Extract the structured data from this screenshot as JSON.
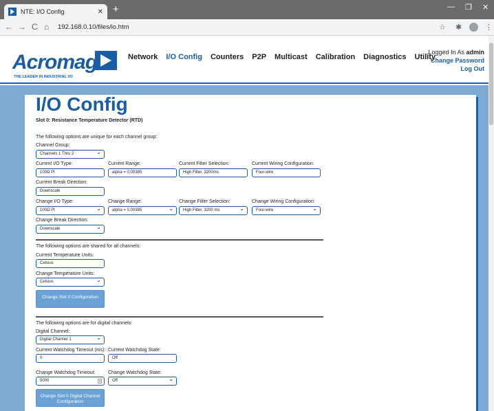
{
  "browser": {
    "tab_title": "NTE: I/O Config",
    "url": "192.168.0.10/files/io.htm"
  },
  "header": {
    "brand": "Acromag",
    "tagline": "THE LEADER IN INDUSTRIAL I/O",
    "nav": [
      "Network",
      "I/O Config",
      "Counters",
      "P2P",
      "Multicast",
      "Calibration",
      "Diagnostics",
      "Utility"
    ],
    "logged_in_prefix": "Logged In As ",
    "user": "admin",
    "change_password": "Change Password",
    "logout": "Log Out"
  },
  "main": {
    "title": "I/O Config",
    "slot_title": "Slot 0: Resistance Temperature Detector (RTD)",
    "unique_note": "The following options are unique for each channel group:",
    "channel_group_label": "Channel Group:",
    "channel_group_value": "Channels 1 Thru 2",
    "current_io_type_label": "Current I/O Type:",
    "current_io_type": "100Ω Pt",
    "current_range_label": "Current Range:",
    "current_range": "alpha = 0.00385",
    "current_filter_label": "Current Filter Selection:",
    "current_filter": "High Filter, 3200ms",
    "current_wiring_label": "Current Wiring Configuration:",
    "current_wiring": "Four-wire",
    "current_break_label": "Current Break Direction:",
    "current_break": "Downscale",
    "change_io_type_label": "Change I/O Type:",
    "change_io_type": "100Ω Pt",
    "change_range_label": "Change Range:",
    "change_range": "alpha = 0.00385",
    "change_filter_label": "Change Filter Selection:",
    "change_filter": "High Filter, 3200 ms",
    "change_wiring_label": "Change Wiring Configuration:",
    "change_wiring": "Four-wire",
    "change_break_label": "Change Break Direction:",
    "change_break": "Downscale",
    "shared_note": "The following options are shared for all channels:",
    "current_temp_units_label": "Current Temperature Units:",
    "current_temp_units": "Celsius",
    "change_temp_units_label": "Change Temperature Units:",
    "change_temp_units": "Celsius",
    "change_config_button": "Change Slot 0 Configuration",
    "digital_note": "The following options are for digital channels:",
    "digital_channel_label": "Digital Channel:",
    "digital_channel": "Digital Channel 1",
    "current_watchdog_timeout_label": "Current Watchdog Timeout (ms):",
    "current_watchdog_timeout": "0",
    "current_watchdog_state_label": "Current Watchdog State:",
    "current_watchdog_state": "Off",
    "change_watchdog_timeout_label": "Change Watchdog Timeout:",
    "change_watchdog_timeout": "5000",
    "change_watchdog_state_label": "Change Watchdog State:",
    "change_watchdog_state": "Off",
    "change_digital_button": "Change Slot 0 Digital Channel Configuration"
  }
}
